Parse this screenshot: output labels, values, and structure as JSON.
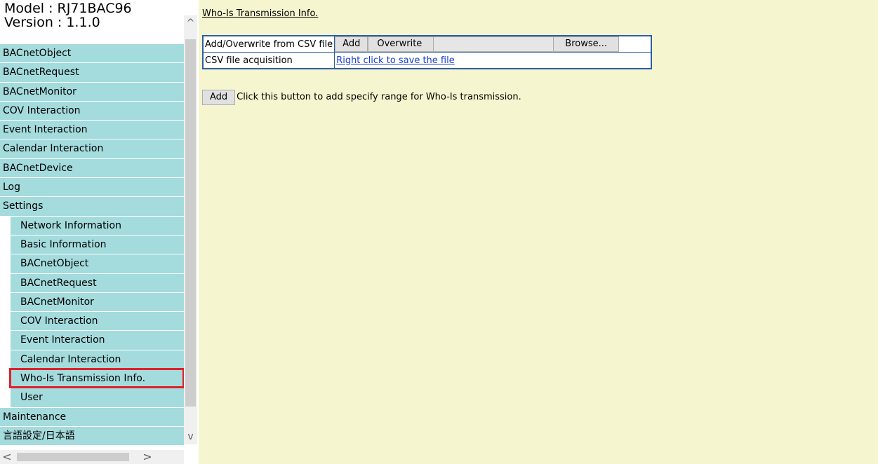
{
  "sidebar": {
    "model": "Model : RJ71BAC96",
    "version": "Version : 1.1.0",
    "items": [
      {
        "label": "BACnetObject"
      },
      {
        "label": "BACnetRequest"
      },
      {
        "label": "BACnetMonitor"
      },
      {
        "label": "COV Interaction"
      },
      {
        "label": "Event Interaction"
      },
      {
        "label": "Calendar Interaction"
      },
      {
        "label": "BACnetDevice"
      },
      {
        "label": "Log"
      },
      {
        "label": "Settings"
      },
      {
        "label": "Network Information"
      },
      {
        "label": "Basic Information"
      },
      {
        "label": "BACnetObject"
      },
      {
        "label": "BACnetRequest"
      },
      {
        "label": "BACnetMonitor"
      },
      {
        "label": "COV Interaction"
      },
      {
        "label": "Event Interaction"
      },
      {
        "label": "Calendar Interaction"
      },
      {
        "label": "Who-Is Transmission Info."
      },
      {
        "label": "User"
      },
      {
        "label": "Maintenance"
      },
      {
        "label": "言語設定/日本語"
      }
    ],
    "selected": "Who-Is Transmission Info.",
    "highlight_color": "#e0202a",
    "item_color": "#a4dbdd"
  },
  "scrollbars": {
    "up_arrow": "^",
    "down_arrow": "v",
    "left_arrow": "<",
    "right_arrow": ">"
  },
  "main": {
    "title": "Who-Is Transmission Info.",
    "background": "#f5f5cf",
    "csv_table": {
      "row1_label": "Add/Overwrite from CSV file",
      "add_button": "Add",
      "overwrite_button": "Overwrite",
      "browse_button": "Browse...",
      "row2_label": "CSV file acquisition",
      "row2_link": "Right click to save the file"
    },
    "add_button": "Add",
    "add_hint": "Click this button to add specify range for Who-Is transmission."
  }
}
